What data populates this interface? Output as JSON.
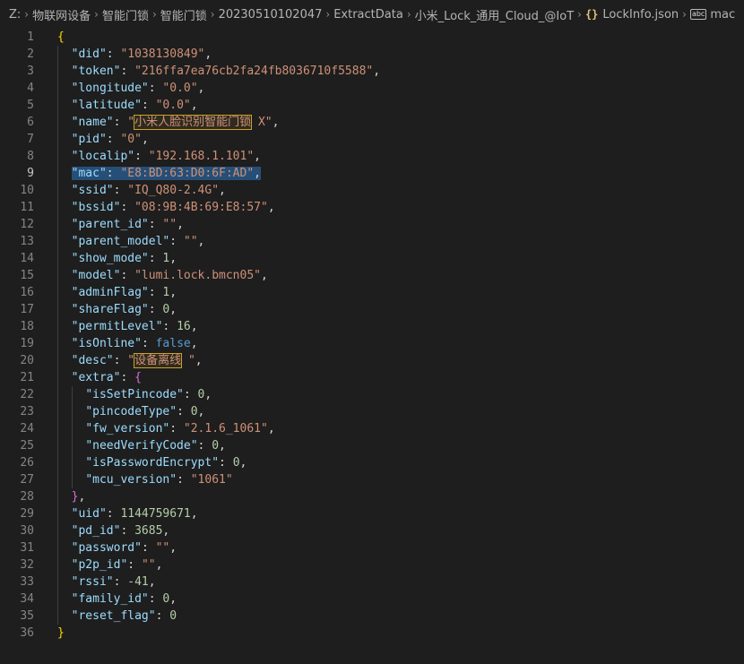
{
  "breadcrumb": [
    "Z:",
    "物联网设备",
    "智能门锁",
    "智能门锁",
    "20230510102047",
    "ExtractData",
    "小米_Lock_通用_Cloud_@IoT",
    "LockInfo.json",
    "mac"
  ],
  "editor": {
    "active_line": 9,
    "open_brace": "{",
    "close_brace": "}",
    "fields": [
      {
        "key": "\"did\"",
        "value": "\"1038130849\"",
        "type": "string"
      },
      {
        "key": "\"token\"",
        "value": "\"216ffa7ea76cb2fa24fb8036710f5588\"",
        "type": "string"
      },
      {
        "key": "\"longitude\"",
        "value": "\"0.0\"",
        "type": "string"
      },
      {
        "key": "\"latitude\"",
        "value": "\"0.0\"",
        "type": "string"
      },
      {
        "key": "\"name\"",
        "value_pre": "\"",
        "value_hl": "小米人脸识别智能门锁",
        "value_post": " X\"",
        "type": "string-hl"
      },
      {
        "key": "\"pid\"",
        "value": "\"0\"",
        "type": "string"
      },
      {
        "key": "\"localip\"",
        "value": "\"192.168.1.101\"",
        "type": "string"
      },
      {
        "key": "\"mac\"",
        "value": "\"E8:BD:63:D0:6F:AD\"",
        "type": "string",
        "selected": true
      },
      {
        "key": "\"ssid\"",
        "value": "\"IQ_Q80-2.4G\"",
        "type": "string"
      },
      {
        "key": "\"bssid\"",
        "value": "\"08:9B:4B:69:E8:57\"",
        "type": "string"
      },
      {
        "key": "\"parent_id\"",
        "value": "\"\"",
        "type": "string"
      },
      {
        "key": "\"parent_model\"",
        "value": "\"\"",
        "type": "string"
      },
      {
        "key": "\"show_mode\"",
        "value": "1",
        "type": "number"
      },
      {
        "key": "\"model\"",
        "value": "\"lumi.lock.bmcn05\"",
        "type": "string"
      },
      {
        "key": "\"adminFlag\"",
        "value": "1",
        "type": "number"
      },
      {
        "key": "\"shareFlag\"",
        "value": "0",
        "type": "number"
      },
      {
        "key": "\"permitLevel\"",
        "value": "16",
        "type": "number"
      },
      {
        "key": "\"isOnline\"",
        "value": "false",
        "type": "bool"
      },
      {
        "key": "\"desc\"",
        "value_pre": "\"",
        "value_hl": "设备离线",
        "value_post": " \"",
        "type": "string-hl"
      },
      {
        "key": "\"extra\"",
        "value": "{",
        "type": "open"
      },
      {
        "key": "\"isSetPincode\"",
        "value": "0",
        "type": "number",
        "nested": true
      },
      {
        "key": "\"pincodeType\"",
        "value": "0",
        "type": "number",
        "nested": true
      },
      {
        "key": "\"fw_version\"",
        "value": "\"2.1.6_1061\"",
        "type": "string",
        "nested": true
      },
      {
        "key": "\"needVerifyCode\"",
        "value": "0",
        "type": "number",
        "nested": true
      },
      {
        "key": "\"isPasswordEncrypt\"",
        "value": "0",
        "type": "number",
        "nested": true
      },
      {
        "key": "\"mcu_version\"",
        "value": "\"1061\"",
        "type": "string",
        "nested": true,
        "last": true
      },
      {
        "value": "}",
        "type": "close"
      },
      {
        "key": "\"uid\"",
        "value": "1144759671",
        "type": "number"
      },
      {
        "key": "\"pd_id\"",
        "value": "3685",
        "type": "number"
      },
      {
        "key": "\"password\"",
        "value": "\"\"",
        "type": "string"
      },
      {
        "key": "\"p2p_id\"",
        "value": "\"\"",
        "type": "string"
      },
      {
        "key": "\"rssi\"",
        "value": "-41",
        "type": "number"
      },
      {
        "key": "\"family_id\"",
        "value": "0",
        "type": "number"
      },
      {
        "key": "\"reset_flag\"",
        "value": "0",
        "type": "number",
        "last": true
      }
    ]
  }
}
